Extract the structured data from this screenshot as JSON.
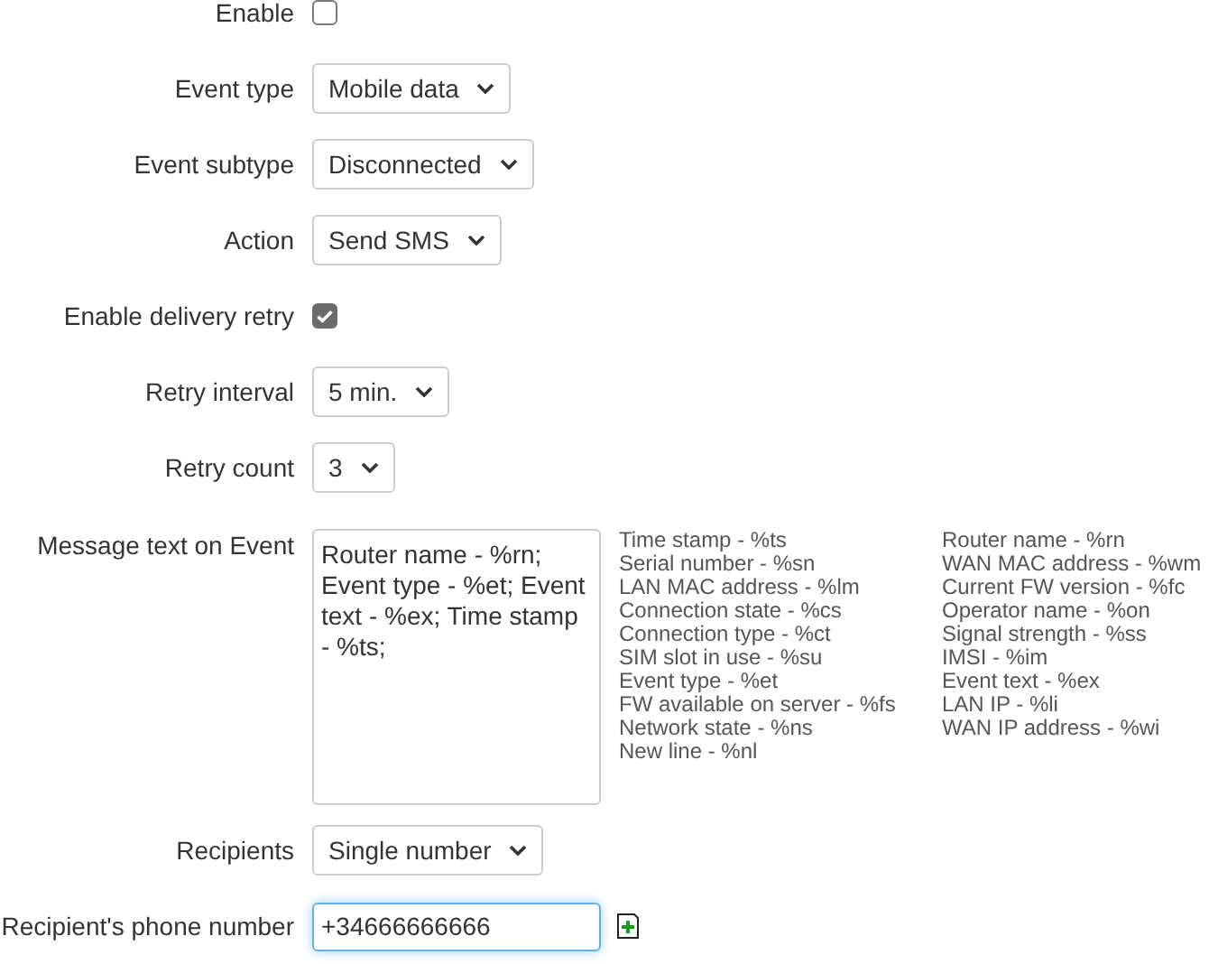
{
  "fields": [
    {
      "kind": "checkbox",
      "label": "Enable",
      "checked": false
    },
    {
      "kind": "select",
      "label": "Event type",
      "value": "Mobile data"
    },
    {
      "kind": "select",
      "label": "Event subtype",
      "value": "Disconnected"
    },
    {
      "kind": "select",
      "label": "Action",
      "value": "Send SMS"
    },
    {
      "kind": "checkbox",
      "label": "Enable delivery retry",
      "checked": true
    },
    {
      "kind": "select",
      "label": "Retry interval",
      "value": "5 min."
    },
    {
      "kind": "select",
      "label": "Retry count",
      "value": "3"
    },
    {
      "kind": "textarea",
      "label": "Message text on Event",
      "value": "Router name - %rn; Event type - %et; Event text - %ex; Time stamp - %ts;",
      "hints": [
        [
          "Time stamp - %ts",
          "Serial number - %sn",
          "LAN MAC address - %lm",
          "Connection state - %cs",
          "Connection type - %ct",
          "SIM slot in use - %su",
          "Event type - %et",
          "FW available on server - %fs",
          "Network state - %ns",
          "New line - %nl"
        ],
        [
          "Router name - %rn",
          "WAN MAC address - %wm",
          "Current FW version - %fc",
          "Operator name - %on",
          "Signal strength - %ss",
          "IMSI - %im",
          "Event text - %ex",
          "LAN IP - %li",
          "WAN IP address - %wi"
        ]
      ]
    },
    {
      "kind": "select",
      "label": "Recipients",
      "value": "Single number"
    },
    {
      "kind": "text",
      "label": "Recipient's phone number",
      "value": "+34666666666",
      "focused": true
    }
  ]
}
